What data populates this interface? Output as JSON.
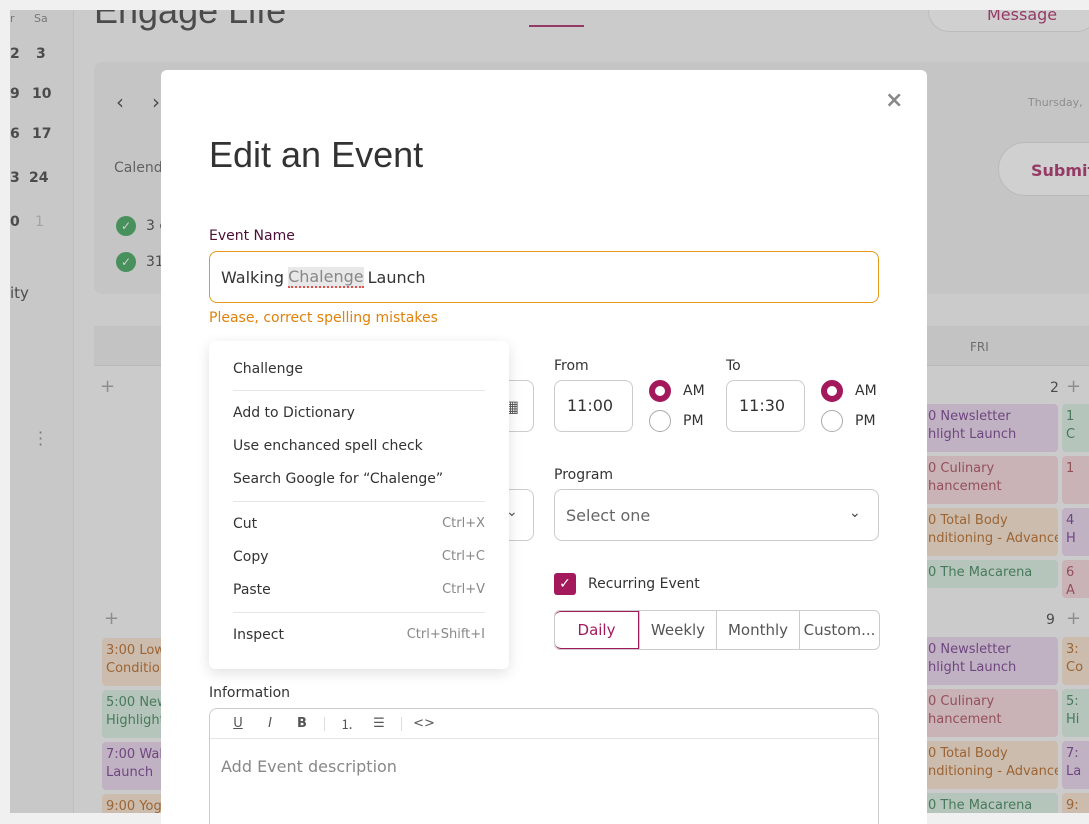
{
  "background": {
    "app_title": "Engage Life",
    "message_button": "Message",
    "mini_calendar": {
      "dow": [
        "r",
        "Sa"
      ],
      "rows": [
        [
          "2",
          "3"
        ],
        [
          "9",
          "10"
        ],
        [
          "6",
          "17"
        ],
        [
          "3",
          "24"
        ],
        [
          "0",
          "1"
        ]
      ],
      "truncated_label": "ity"
    },
    "date_text": "Thursday,",
    "calendar_label": "Calenda",
    "submit_button": "Submit",
    "check_items": [
      "3 c",
      "31"
    ],
    "weekday_header": "FRI",
    "week1": {
      "num_sat": "2",
      "events_fri": [
        "0 Newsletter\nhlight Launch",
        "0 Culinary\nhancement",
        "0 Total Body\nnditioning - Advance",
        "0 The Macarena"
      ],
      "events_sat": [
        "1\nC",
        "1\n",
        "4\nH",
        "6\nA"
      ]
    },
    "week2": {
      "num_sat": "9",
      "events_fri": [
        "0 Newsletter\nhlight Launch",
        "0 Culinary\nhancement",
        "0 Total Body\nnditioning - Advance",
        "0 The Macarena"
      ],
      "events_sat": [
        "3:\nCo",
        "5:\nHi",
        "7:\nLa",
        "9:"
      ],
      "events_sun": [
        "3:00 Low\nCondition",
        "5:00 New\nHighlights",
        "7:00 Wall\nLaunch",
        "9:00 Yoga"
      ]
    }
  },
  "modal": {
    "title": "Edit an Event",
    "close_label": "×",
    "event_name_label": "Event Name",
    "event_name_parts": [
      "Walking",
      "Chalenge",
      "Launch"
    ],
    "error_text": "Please, correct spelling mistakes",
    "from_label": "From",
    "to_label": "To",
    "from_time": "11:00",
    "to_time": "11:30",
    "am_label": "AM",
    "pm_label": "PM",
    "from_am_selected": true,
    "to_am_selected": true,
    "program_label": "Program",
    "program_placeholder": "Select one",
    "recurring_label": "Recurring Event",
    "recurring_checked": true,
    "recurrence_options": [
      "Daily",
      "Weekly",
      "Monthly",
      "Custom..."
    ],
    "recurrence_selected": "Daily",
    "information_label": "Information",
    "toolbar_icons": [
      "underline-icon",
      "italic-icon",
      "bold-icon",
      "ordered-list-icon",
      "bullet-list-icon",
      "code-icon"
    ],
    "description_placeholder": "Add Event description"
  },
  "context_menu": {
    "suggestion": "Challenge",
    "add_to_dictionary": "Add to Dictionary",
    "enhanced_spell": "Use enchanced spell check",
    "search_google": "Search Google for “Chalenge”",
    "cut": {
      "label": "Cut",
      "shortcut": "Ctrl+X"
    },
    "copy": {
      "label": "Copy",
      "shortcut": "Ctrl+C"
    },
    "paste": {
      "label": "Paste",
      "shortcut": "Ctrl+V"
    },
    "inspect": {
      "label": "Inspect",
      "shortcut": "Ctrl+Shift+I"
    }
  },
  "colors": {
    "brand": "#a3195b",
    "error": "#e0820a",
    "check_green": "#2e9e4f"
  }
}
